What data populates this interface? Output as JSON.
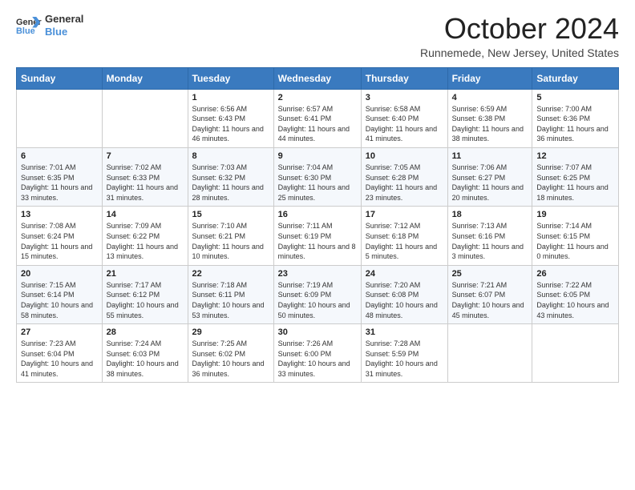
{
  "header": {
    "logo_line1": "General",
    "logo_line2": "Blue",
    "month_title": "October 2024",
    "location": "Runnemede, New Jersey, United States"
  },
  "days_of_week": [
    "Sunday",
    "Monday",
    "Tuesday",
    "Wednesday",
    "Thursday",
    "Friday",
    "Saturday"
  ],
  "weeks": [
    [
      {
        "day": "",
        "info": ""
      },
      {
        "day": "",
        "info": ""
      },
      {
        "day": "1",
        "info": "Sunrise: 6:56 AM\nSunset: 6:43 PM\nDaylight: 11 hours and 46 minutes."
      },
      {
        "day": "2",
        "info": "Sunrise: 6:57 AM\nSunset: 6:41 PM\nDaylight: 11 hours and 44 minutes."
      },
      {
        "day": "3",
        "info": "Sunrise: 6:58 AM\nSunset: 6:40 PM\nDaylight: 11 hours and 41 minutes."
      },
      {
        "day": "4",
        "info": "Sunrise: 6:59 AM\nSunset: 6:38 PM\nDaylight: 11 hours and 38 minutes."
      },
      {
        "day": "5",
        "info": "Sunrise: 7:00 AM\nSunset: 6:36 PM\nDaylight: 11 hours and 36 minutes."
      }
    ],
    [
      {
        "day": "6",
        "info": "Sunrise: 7:01 AM\nSunset: 6:35 PM\nDaylight: 11 hours and 33 minutes."
      },
      {
        "day": "7",
        "info": "Sunrise: 7:02 AM\nSunset: 6:33 PM\nDaylight: 11 hours and 31 minutes."
      },
      {
        "day": "8",
        "info": "Sunrise: 7:03 AM\nSunset: 6:32 PM\nDaylight: 11 hours and 28 minutes."
      },
      {
        "day": "9",
        "info": "Sunrise: 7:04 AM\nSunset: 6:30 PM\nDaylight: 11 hours and 25 minutes."
      },
      {
        "day": "10",
        "info": "Sunrise: 7:05 AM\nSunset: 6:28 PM\nDaylight: 11 hours and 23 minutes."
      },
      {
        "day": "11",
        "info": "Sunrise: 7:06 AM\nSunset: 6:27 PM\nDaylight: 11 hours and 20 minutes."
      },
      {
        "day": "12",
        "info": "Sunrise: 7:07 AM\nSunset: 6:25 PM\nDaylight: 11 hours and 18 minutes."
      }
    ],
    [
      {
        "day": "13",
        "info": "Sunrise: 7:08 AM\nSunset: 6:24 PM\nDaylight: 11 hours and 15 minutes."
      },
      {
        "day": "14",
        "info": "Sunrise: 7:09 AM\nSunset: 6:22 PM\nDaylight: 11 hours and 13 minutes."
      },
      {
        "day": "15",
        "info": "Sunrise: 7:10 AM\nSunset: 6:21 PM\nDaylight: 11 hours and 10 minutes."
      },
      {
        "day": "16",
        "info": "Sunrise: 7:11 AM\nSunset: 6:19 PM\nDaylight: 11 hours and 8 minutes."
      },
      {
        "day": "17",
        "info": "Sunrise: 7:12 AM\nSunset: 6:18 PM\nDaylight: 11 hours and 5 minutes."
      },
      {
        "day": "18",
        "info": "Sunrise: 7:13 AM\nSunset: 6:16 PM\nDaylight: 11 hours and 3 minutes."
      },
      {
        "day": "19",
        "info": "Sunrise: 7:14 AM\nSunset: 6:15 PM\nDaylight: 11 hours and 0 minutes."
      }
    ],
    [
      {
        "day": "20",
        "info": "Sunrise: 7:15 AM\nSunset: 6:14 PM\nDaylight: 10 hours and 58 minutes."
      },
      {
        "day": "21",
        "info": "Sunrise: 7:17 AM\nSunset: 6:12 PM\nDaylight: 10 hours and 55 minutes."
      },
      {
        "day": "22",
        "info": "Sunrise: 7:18 AM\nSunset: 6:11 PM\nDaylight: 10 hours and 53 minutes."
      },
      {
        "day": "23",
        "info": "Sunrise: 7:19 AM\nSunset: 6:09 PM\nDaylight: 10 hours and 50 minutes."
      },
      {
        "day": "24",
        "info": "Sunrise: 7:20 AM\nSunset: 6:08 PM\nDaylight: 10 hours and 48 minutes."
      },
      {
        "day": "25",
        "info": "Sunrise: 7:21 AM\nSunset: 6:07 PM\nDaylight: 10 hours and 45 minutes."
      },
      {
        "day": "26",
        "info": "Sunrise: 7:22 AM\nSunset: 6:05 PM\nDaylight: 10 hours and 43 minutes."
      }
    ],
    [
      {
        "day": "27",
        "info": "Sunrise: 7:23 AM\nSunset: 6:04 PM\nDaylight: 10 hours and 41 minutes."
      },
      {
        "day": "28",
        "info": "Sunrise: 7:24 AM\nSunset: 6:03 PM\nDaylight: 10 hours and 38 minutes."
      },
      {
        "day": "29",
        "info": "Sunrise: 7:25 AM\nSunset: 6:02 PM\nDaylight: 10 hours and 36 minutes."
      },
      {
        "day": "30",
        "info": "Sunrise: 7:26 AM\nSunset: 6:00 PM\nDaylight: 10 hours and 33 minutes."
      },
      {
        "day": "31",
        "info": "Sunrise: 7:28 AM\nSunset: 5:59 PM\nDaylight: 10 hours and 31 minutes."
      },
      {
        "day": "",
        "info": ""
      },
      {
        "day": "",
        "info": ""
      }
    ]
  ]
}
